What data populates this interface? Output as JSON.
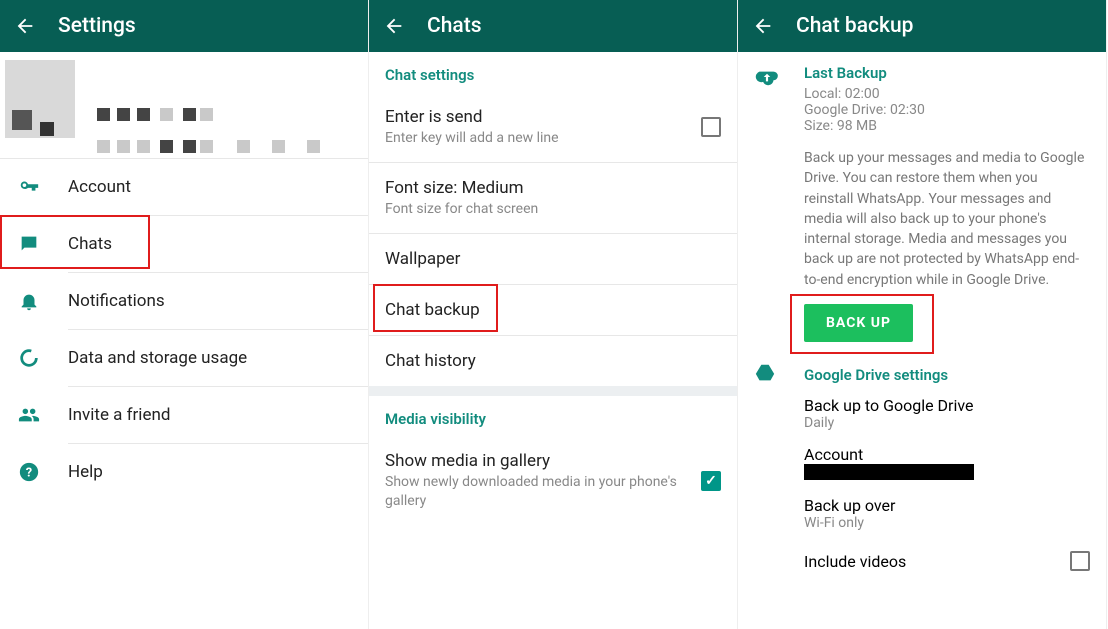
{
  "col1": {
    "title": "Settings",
    "items": {
      "account": "Account",
      "chats": "Chats",
      "notifications": "Notifications",
      "data": "Data and storage usage",
      "invite": "Invite a friend",
      "help": "Help"
    }
  },
  "col2": {
    "title": "Chats",
    "chat_settings_hdr": "Chat settings",
    "enter_title": "Enter is send",
    "enter_sub": "Enter key will add a new line",
    "font_title": "Font size: Medium",
    "font_sub": "Font size for chat screen",
    "wallpaper": "Wallpaper",
    "chat_backup": "Chat backup",
    "chat_history": "Chat history",
    "media_hdr": "Media visibility",
    "media_title": "Show media in gallery",
    "media_sub": "Show newly downloaded media in your phone's gallery"
  },
  "col3": {
    "title": "Chat backup",
    "last_backup": "Last Backup",
    "local": "Local: 02:00",
    "gdrive_time": "Google Drive: 02:30",
    "size": "Size: 98 MB",
    "desc": "Back up your messages and media to Google Drive. You can restore them when you reinstall WhatsApp. Your messages and media will also back up to your phone's internal storage. Media and messages you back up are not protected by WhatsApp end-to-end encryption while in Google Drive.",
    "backup_btn": "BACK UP",
    "gdrive_hdr": "Google Drive settings",
    "backup_to": "Back up to Google Drive",
    "backup_to_sub": "Daily",
    "account": "Account",
    "backup_over": "Back up over",
    "backup_over_sub": "Wi-Fi only",
    "include_videos": "Include videos"
  }
}
